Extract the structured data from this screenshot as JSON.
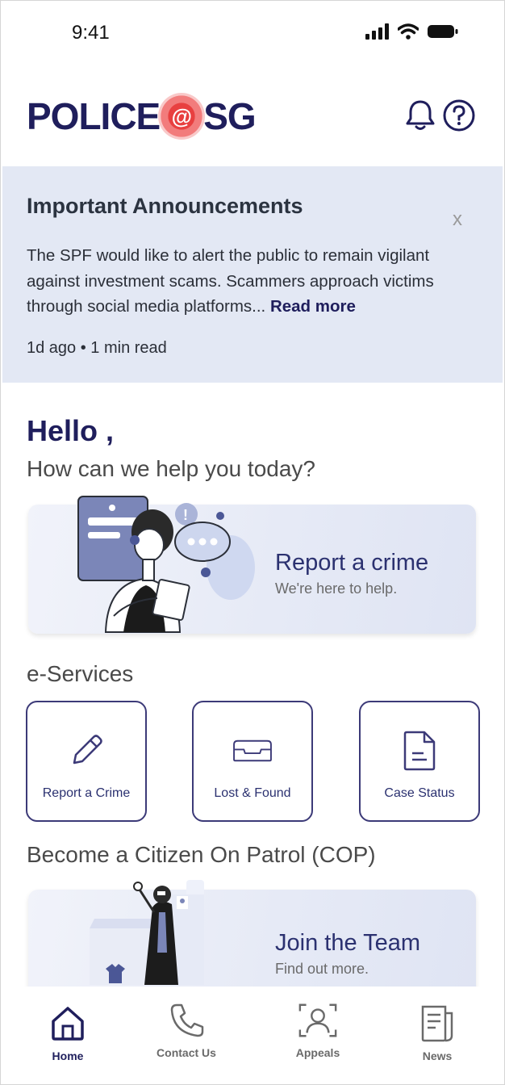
{
  "status_bar": {
    "time": "9:41"
  },
  "header": {
    "logo_left": "POLICE",
    "logo_at": "@",
    "logo_right": "SG",
    "icons": [
      "bell-icon",
      "help-icon"
    ]
  },
  "announcement": {
    "title": "Important Announcements",
    "close_label": "x",
    "body": "The SPF would like to alert the public to remain vigilant against investment scams. Scammers approach victims through social media platforms... ",
    "read_more": "Read more",
    "meta": "1d ago • 1 min read"
  },
  "greeting": {
    "hello": "Hello ,",
    "subtitle": "How can we help you today?"
  },
  "report_card": {
    "title": "Report a crime",
    "subtitle": "We're here to help."
  },
  "eservices": {
    "heading": "e-Services",
    "items": [
      {
        "label": "Report a Crime",
        "icon": "pencil-icon"
      },
      {
        "label": "Lost & Found",
        "icon": "tray-icon"
      },
      {
        "label": "Case Status",
        "icon": "document-icon"
      }
    ]
  },
  "cop": {
    "heading": "Become a Citizen On Patrol (COP)",
    "card_title": "Join the Team",
    "card_subtitle": "Find out more."
  },
  "bottom_nav": {
    "items": [
      {
        "label": "Home",
        "icon": "home-icon",
        "active": true
      },
      {
        "label": "Contact Us",
        "icon": "phone-icon",
        "active": false
      },
      {
        "label": "Appeals",
        "icon": "person-scan-icon",
        "active": false
      },
      {
        "label": "News",
        "icon": "newspaper-icon",
        "active": false
      }
    ]
  },
  "colors": {
    "brand_navy": "#1f1e5c",
    "accent_red": "#e84040",
    "announcement_bg": "#e3e8f4"
  }
}
